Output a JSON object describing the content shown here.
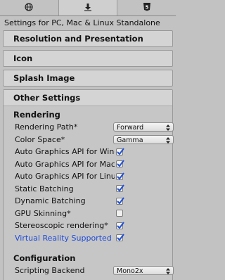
{
  "tabs": [
    {
      "icon": "globe-icon",
      "active": false
    },
    {
      "icon": "download-icon",
      "active": true
    },
    {
      "icon": "html5-icon",
      "active": false,
      "glyph": "5"
    }
  ],
  "header": {
    "settings_for": "Settings for PC, Mac & Linux Standalone"
  },
  "sections": {
    "resolution": "Resolution and Presentation",
    "icon": "Icon",
    "splash": "Splash Image",
    "other": "Other Settings"
  },
  "rendering": {
    "title": "Rendering",
    "rendering_path": {
      "label": "Rendering Path*",
      "value": "Forward"
    },
    "color_space": {
      "label": "Color Space*",
      "value": "Gamma"
    },
    "checks": [
      {
        "label": "Auto Graphics API for Windows",
        "checked": true
      },
      {
        "label": "Auto Graphics API for Mac",
        "checked": true
      },
      {
        "label": "Auto Graphics API for Linux",
        "checked": true
      },
      {
        "label": "Static Batching",
        "checked": true
      },
      {
        "label": "Dynamic Batching",
        "checked": true
      },
      {
        "label": "GPU Skinning*",
        "checked": false
      },
      {
        "label": "Stereoscopic rendering*",
        "checked": true
      },
      {
        "label": "Virtual Reality Supported",
        "checked": true
      }
    ]
  },
  "configuration": {
    "title": "Configuration",
    "scripting_backend": {
      "label": "Scripting Backend",
      "value": "Mono2x"
    }
  }
}
